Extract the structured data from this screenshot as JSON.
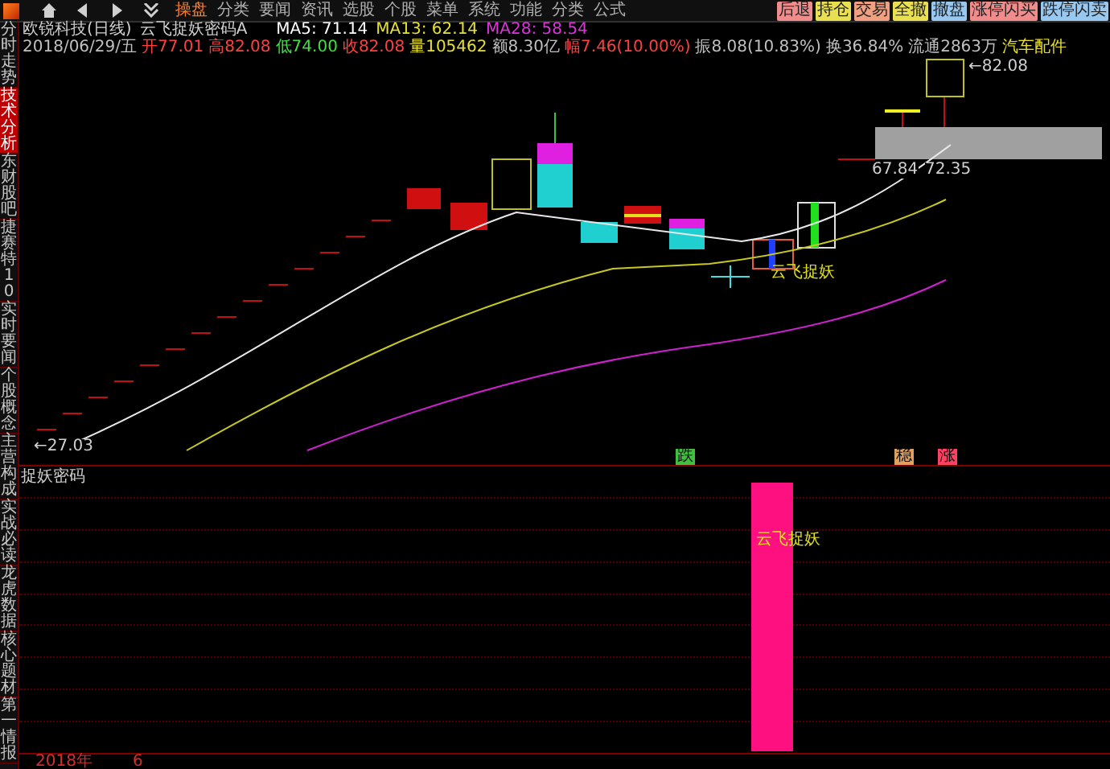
{
  "menu_bar": {
    "items": [
      {
        "label": "操盘",
        "selected": true
      },
      {
        "label": "分类",
        "selected": false
      },
      {
        "label": "要闻",
        "selected": false
      },
      {
        "label": "资讯",
        "selected": false
      },
      {
        "label": "选股",
        "selected": false
      },
      {
        "label": "个股",
        "selected": false
      },
      {
        "label": "菜单",
        "selected": false
      },
      {
        "label": "系统",
        "selected": false
      },
      {
        "label": "功能",
        "selected": false
      },
      {
        "label": "分类",
        "selected": false
      },
      {
        "label": "公式",
        "selected": false
      }
    ],
    "action_buttons": [
      {
        "label": "后退",
        "color": "#f08c8c"
      },
      {
        "label": "持仓",
        "color": "#e8e050"
      },
      {
        "label": "交易",
        "color": "#f0a080"
      },
      {
        "label": "全撤",
        "color": "#e8e050"
      },
      {
        "label": "撤盘",
        "color": "#98c8f0"
      },
      {
        "label": "涨停闪买",
        "color": "#f08c8c"
      },
      {
        "label": "跌停闪卖",
        "color": "#98c8f0"
      }
    ]
  },
  "stock_header": {
    "name": "欧锐科技(日线)",
    "indicator": "云飞捉妖密码A",
    "ma": [
      {
        "label": "MA5: 71.14",
        "color": "#ffffff"
      },
      {
        "label": "MA13: 62.14",
        "color": "#e8e030"
      },
      {
        "label": "MA28: 58.54",
        "color": "#e030e0"
      }
    ]
  },
  "quote_line": [
    {
      "text": "2018/06/29/五",
      "color": "#c0c0c0"
    },
    {
      "text": "开77.01",
      "color": "#ff4040"
    },
    {
      "text": "高82.08",
      "color": "#ff4040"
    },
    {
      "text": "低74.00",
      "color": "#40e040"
    },
    {
      "text": "收82.08",
      "color": "#ff4040"
    },
    {
      "text": "量105462",
      "color": "#e8e030"
    },
    {
      "text": "额8.30亿",
      "color": "#c0c0c0"
    },
    {
      "text": "幅7.46(10.00%)",
      "color": "#ff4040"
    },
    {
      "text": "振8.08(10.83%)",
      "color": "#c0c0c0"
    },
    {
      "text": "换36.84%",
      "color": "#c0c0c0"
    },
    {
      "text": "流通2863万",
      "color": "#c0c0c0"
    },
    {
      "text": "汽车配件",
      "color": "#e8e030"
    }
  ],
  "sidebar": {
    "top_tabs": [
      {
        "label": "分时走势",
        "selected": false
      },
      {
        "label": "技术分析",
        "selected": true
      },
      {
        "label": "东财股吧",
        "selected": false
      },
      {
        "label": "捷赛特10",
        "selected": false
      },
      {
        "label": "实时要闻",
        "selected": false
      },
      {
        "label": "个股概念",
        "selected": false
      },
      {
        "label": "主营构成",
        "selected": false
      },
      {
        "label": "实战必读",
        "selected": false
      }
    ],
    "bottom_tabs": [
      {
        "label": "龙虎数据",
        "selected": false
      },
      {
        "label": "核心题材",
        "selected": false
      },
      {
        "label": "第一情报",
        "selected": false
      }
    ]
  },
  "chart": {
    "low_label": "←27.03",
    "high_label": "←82.08",
    "range_labels": [
      "67.84",
      "72.35"
    ],
    "signal_label": "云飞捉妖",
    "markers": [
      {
        "text": "跌",
        "color": "#40c040"
      },
      {
        "text": "稳",
        "color": "#e0a060"
      },
      {
        "text": "涨",
        "color": "#ff4060"
      }
    ]
  },
  "lower_panel": {
    "title": "捉妖密码",
    "signal_label": "云飞捉妖"
  },
  "time_axis": [
    "2018年",
    "6"
  ]
}
